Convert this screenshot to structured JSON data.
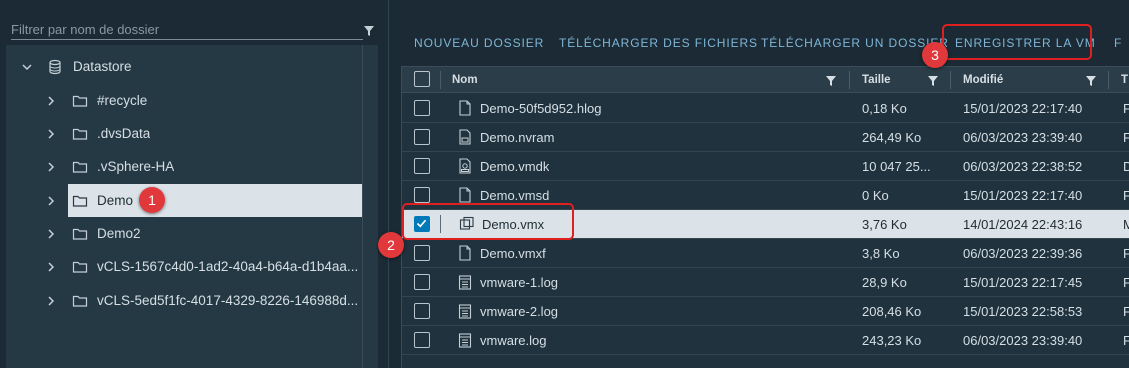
{
  "filter": {
    "placeholder": "Filtrer par nom de dossier"
  },
  "tree": {
    "root": "Datastore",
    "items": [
      {
        "label": "#recycle"
      },
      {
        "label": ".dvsData"
      },
      {
        "label": ".vSphere-HA"
      },
      {
        "label": "Demo"
      },
      {
        "label": "Demo2"
      },
      {
        "label": "vCLS-1567c4d0-1ad2-40a4-b64a-d1b4aa..."
      },
      {
        "label": "vCLS-5ed5f1fc-4017-4329-8226-146988d..."
      }
    ]
  },
  "toolbar": {
    "new_folder": "NOUVEAU DOSSIER",
    "upload_files": "TÉLÉCHARGER DES FICHIERS",
    "upload_folder": "TÉLÉCHARGER UN DOSSIER",
    "register_vm": "ENREGISTRER LA VM",
    "more": "F"
  },
  "table": {
    "columns": {
      "name": "Nom",
      "size": "Taille",
      "modified": "Modifié",
      "type": "T"
    },
    "rows": [
      {
        "name": "Demo-50f5d952.hlog",
        "size": "0,18 Ko",
        "modified": "15/01/2023 22:17:40",
        "type": "F",
        "icon": "file-icon",
        "checked": false
      },
      {
        "name": "Demo.nvram",
        "size": "264,49 Ko",
        "modified": "06/03/2023 23:39:40",
        "type": "F",
        "icon": "nvram-file-icon",
        "checked": false
      },
      {
        "name": "Demo.vmdk",
        "size": "10 047 25...",
        "modified": "06/03/2023 22:38:52",
        "type": "D",
        "icon": "disk-file-icon",
        "checked": false
      },
      {
        "name": "Demo.vmsd",
        "size": "0 Ko",
        "modified": "15/01/2023 22:17:40",
        "type": "F",
        "icon": "file-icon",
        "checked": false
      },
      {
        "name": "Demo.vmx",
        "size": "3,76 Ko",
        "modified": "14/01/2024 22:43:16",
        "type": "M",
        "icon": "vm-file-icon",
        "checked": true
      },
      {
        "name": "Demo.vmxf",
        "size": "3,8 Ko",
        "modified": "06/03/2023 22:39:36",
        "type": "F",
        "icon": "file-icon",
        "checked": false
      },
      {
        "name": "vmware-1.log",
        "size": "28,9 Ko",
        "modified": "15/01/2023 22:17:45",
        "type": "F",
        "icon": "log-file-icon",
        "checked": false
      },
      {
        "name": "vmware-2.log",
        "size": "208,46 Ko",
        "modified": "15/01/2023 22:58:53",
        "type": "F",
        "icon": "log-file-icon",
        "checked": false
      },
      {
        "name": "vmware.log",
        "size": "243,23 Ko",
        "modified": "06/03/2023 23:39:40",
        "type": "F",
        "icon": "log-file-icon",
        "checked": false
      }
    ]
  },
  "callouts": {
    "one": "1",
    "two": "2",
    "three": "3"
  },
  "colors": {
    "accent": "#7fb6d8",
    "selected_row": "#dbe3e9",
    "callout": "#e0383b",
    "checkbox_checked": "#0079b8"
  }
}
